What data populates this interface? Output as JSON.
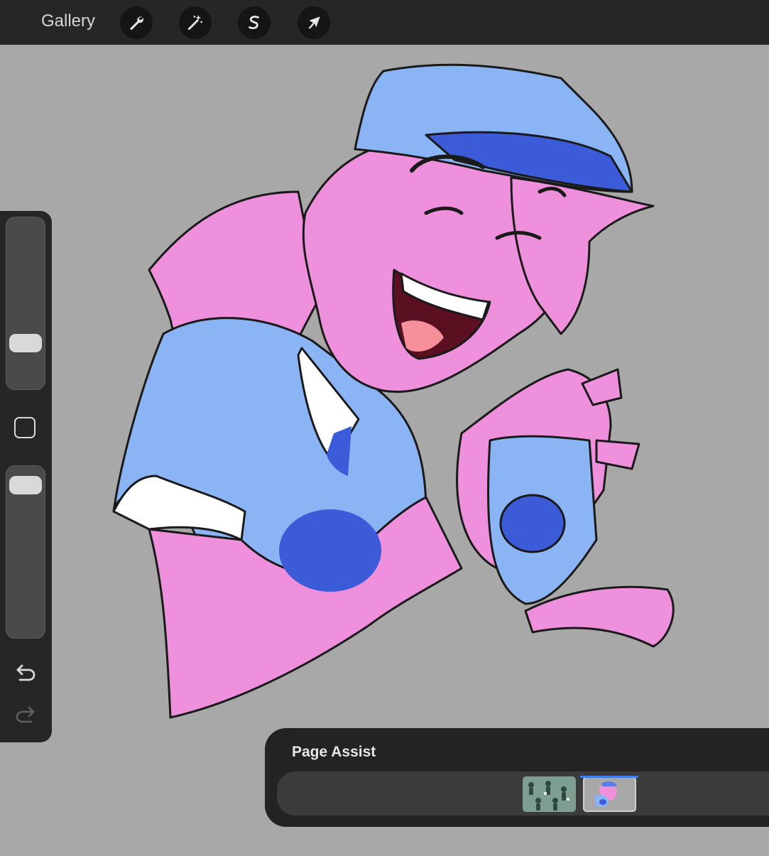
{
  "toolbar": {
    "gallery_label": "Gallery",
    "tools": [
      "wrench-icon",
      "magic-wand-icon",
      "smudge-s-icon",
      "arrow-cursor-icon"
    ]
  },
  "sidebar": {
    "brush_size_level": 0.72,
    "opacity_level": 0.06
  },
  "page_assist": {
    "title": "Page Assist",
    "pages": [
      {
        "name": "page-1",
        "selected": false
      },
      {
        "name": "page-2",
        "selected": true
      }
    ]
  },
  "colors": {
    "chrome": "#262626",
    "canvas": "#a8a8a8",
    "accent": "#3d7df2",
    "skin": "#ef90dc",
    "shirt": "#8ab4f3",
    "cap": "#3c5bd9"
  }
}
